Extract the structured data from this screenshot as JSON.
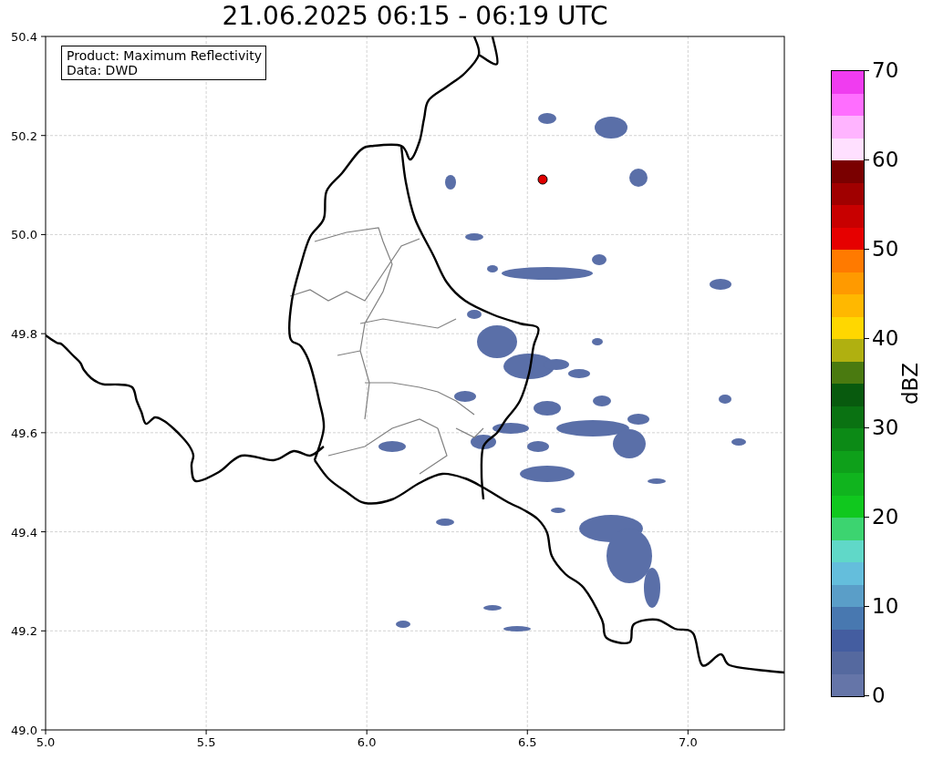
{
  "title": "21.06.2025 06:15 - 06:19 UTC",
  "map": {
    "legend": [
      "Product: Maximum Reflectivity",
      "Data: DWD"
    ],
    "x_ticks": [
      "5.0",
      "5.5",
      "6.0",
      "6.5",
      "7.0"
    ],
    "y_ticks": [
      "50.4",
      "50.2",
      "50.0",
      "49.8",
      "49.6",
      "49.4",
      "49.2",
      "49.0"
    ]
  },
  "colorbar": {
    "label": "dBZ",
    "ticks": [
      "70",
      "60",
      "50",
      "40",
      "30",
      "20",
      "10",
      "0"
    ],
    "bins": [
      {
        "color": "#6575a8"
      },
      {
        "color": "#55699f"
      },
      {
        "color": "#445da0"
      },
      {
        "color": "#4878b0"
      },
      {
        "color": "#5a9ec8"
      },
      {
        "color": "#64bedc"
      },
      {
        "color": "#60d8c8"
      },
      {
        "color": "#3cd470"
      },
      {
        "color": "#10c81e"
      },
      {
        "color": "#10b41e"
      },
      {
        "color": "#0ea01a"
      },
      {
        "color": "#0c8a16"
      },
      {
        "color": "#0a7212"
      },
      {
        "color": "#085a0e"
      },
      {
        "color": "#4a7a10"
      },
      {
        "color": "#b0b010"
      },
      {
        "color": "#ffd700"
      },
      {
        "color": "#ffb800"
      },
      {
        "color": "#ff9a00"
      },
      {
        "color": "#ff7a00"
      },
      {
        "color": "#e60000"
      },
      {
        "color": "#c80000"
      },
      {
        "color": "#a00000"
      },
      {
        "color": "#7a0000"
      },
      {
        "color": "#ffe0ff"
      },
      {
        "color": "#ffb4ff"
      },
      {
        "color": "#ff6eff"
      },
      {
        "color": "#f03cf0"
      }
    ]
  }
}
